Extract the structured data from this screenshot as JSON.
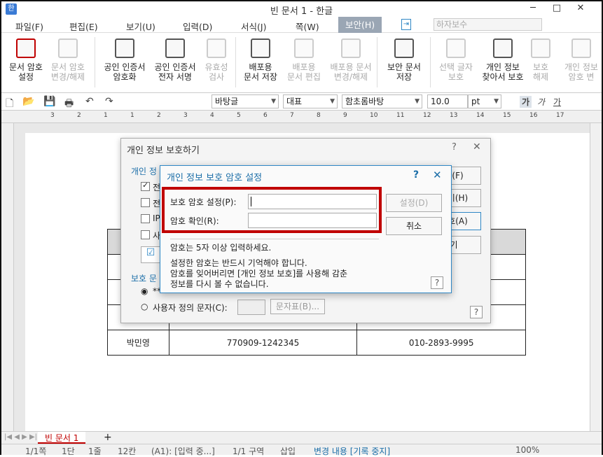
{
  "window": {
    "title": "빈 문서 1 - 한글",
    "minimize": "─",
    "maximize": "□",
    "close": "✕",
    "app_icon": "한"
  },
  "menu": {
    "items": [
      "파일(F)",
      "편집(E)",
      "보기(U)",
      "입력(D)",
      "서식(J)",
      "쪽(W)",
      "보안(H)"
    ],
    "search_placeholder": "하자보수"
  },
  "ribbon": {
    "buttons": [
      {
        "label1": "문서 암호",
        "label2": "설정",
        "enabled": true
      },
      {
        "label1": "문서 암호",
        "label2": "변경/해제",
        "enabled": false
      },
      {
        "label1": "공인 인증서",
        "label2": "암호화",
        "enabled": true
      },
      {
        "label1": "공인 인증서",
        "label2": "전자 서명",
        "enabled": true
      },
      {
        "label1": "유효성",
        "label2": "검사",
        "enabled": false
      },
      {
        "label1": "배포용",
        "label2": "문서 저장",
        "enabled": true
      },
      {
        "label1": "배포용",
        "label2": "문서 편집",
        "enabled": false
      },
      {
        "label1": "배포용 문서",
        "label2": "변경/해제",
        "enabled": false
      },
      {
        "label1": "보안 문서",
        "label2": "저장",
        "enabled": true
      },
      {
        "label1": "선택 글자",
        "label2": "보호",
        "enabled": false
      },
      {
        "label1": "개인 정보",
        "label2": "찾아서 보호",
        "enabled": true
      },
      {
        "label1": "보호",
        "label2": "해제",
        "enabled": false
      },
      {
        "label1": "개인 정보",
        "label2": "암호 변",
        "enabled": false
      }
    ]
  },
  "toolbar": {
    "style": "바탕글",
    "lang": "대표",
    "font": "함초롬바탕",
    "size": "10.0",
    "unit": "pt",
    "bold": "가",
    "italic": "가",
    "underline": "가"
  },
  "ruler": {
    "marks": [
      "3",
      "2",
      "1",
      "1",
      "2",
      "3",
      "4",
      "5",
      "6",
      "7",
      "8",
      "9",
      "10",
      "11",
      "12",
      "13",
      "14",
      "15",
      "16",
      "17"
    ]
  },
  "table": {
    "rows": [
      [
        "",
        "",
        ""
      ],
      [
        "",
        "",
        ""
      ],
      [
        "",
        "",
        ""
      ],
      [
        "",
        "",
        ""
      ],
      [
        "박민영",
        "770909-1242345",
        "010-2893-9995"
      ]
    ]
  },
  "dialog_privacy": {
    "title": "개인 정보 보호하기",
    "section1": "개인 정",
    "check1": "전",
    "check2": "전",
    "check3": "IP",
    "check4": "사",
    "section2": "보호 문",
    "opt1": "**",
    "opt2_label": "사용자 정의 문자(C):",
    "charmap_button": "문자표(B)...",
    "btn1": "기(F)",
    "btn2": "하기(H)",
    "btn3": "보호(A)",
    "btn4": "기",
    "help": "?",
    "close": "✕",
    "help_title": "?"
  },
  "dialog_password": {
    "title": "개인 정보 보호 암호 설정",
    "help": "?",
    "close": "✕",
    "field1_label": "보호 암호 설정(P):",
    "field2_label": "암호 확인(R):",
    "ok_button": "설정(D)",
    "cancel_button": "취소",
    "hint": "암호는 5자 이상 입력하세요.",
    "note1": "설정한 암호는 반드시 기억해야 합니다.",
    "note2": "암호를 잊어버리면 [개인 정보 보호]를 사용해 감춘",
    "note3": "정보를 다시 볼 수 없습니다.",
    "help_button": "?"
  },
  "tabs": {
    "doc_tab": "빈 문서 1",
    "add": "+"
  },
  "status": {
    "page": "1/1쪽",
    "section": "1단",
    "line": "1줄",
    "col": "12칸",
    "mode": "(A1): [입력 중...]",
    "area": "1/1 구역",
    "insert": "삽입",
    "track": "변경 내용 [기록 중지]",
    "zoom": "100%"
  },
  "colors": {
    "highlight": "#c00000",
    "accent": "#2f87c5"
  }
}
